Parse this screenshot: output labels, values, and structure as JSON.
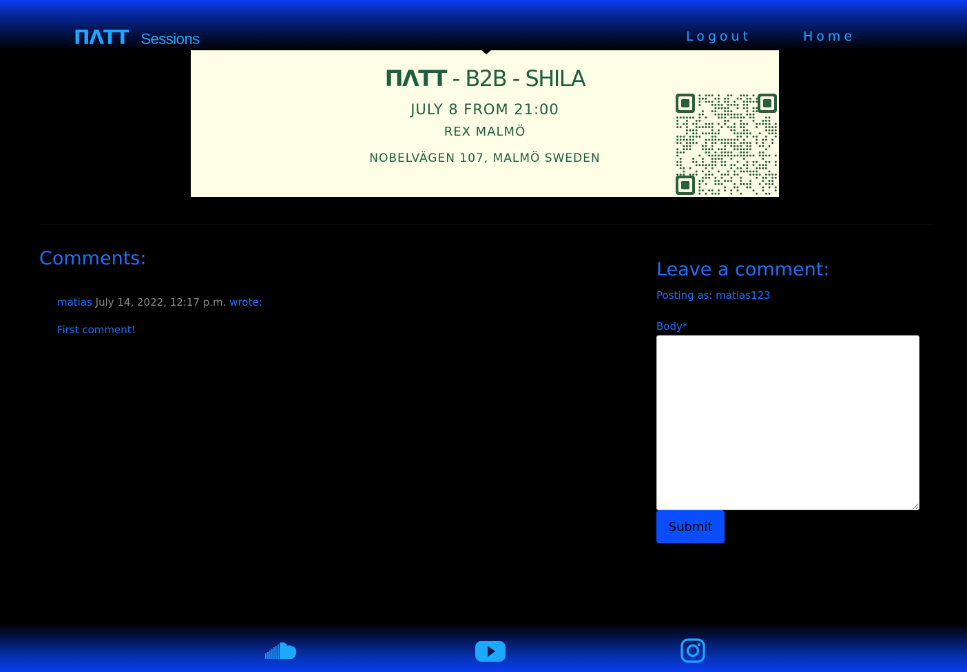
{
  "header": {
    "brand_logo": "ΠΛΤΤ",
    "brand_sub": "Sessions",
    "nav": {
      "logout": "Logout",
      "home": "Home"
    }
  },
  "banner": {
    "title_brand": "ΠΛΤΤ",
    "title_rest": " - B2B - SHILA",
    "date": "JULY 8 FROM 21:00",
    "venue": "REX MALMÖ",
    "address": "NOBELVÄGEN 107, MALMÖ SWEDEN"
  },
  "comments": {
    "heading": "Comments:",
    "items": [
      {
        "author": "matias",
        "date": "July 14, 2022, 12:17 p.m.",
        "wrote": "wrote:",
        "body": "First comment!"
      }
    ]
  },
  "form": {
    "heading": "Leave a comment:",
    "posting_as": "Posting as: matias123",
    "body_label": "Body*",
    "body_value": "",
    "submit_label": "Submit"
  },
  "footer": {
    "icons": [
      "soundcloud-icon",
      "youtube-icon",
      "instagram-icon"
    ]
  },
  "colors": {
    "accent": "#1e6fff",
    "brand": "#1ea7ff",
    "button": "#0a4dff",
    "banner_bg": "#fefee6",
    "banner_text": "#1d5d40"
  }
}
